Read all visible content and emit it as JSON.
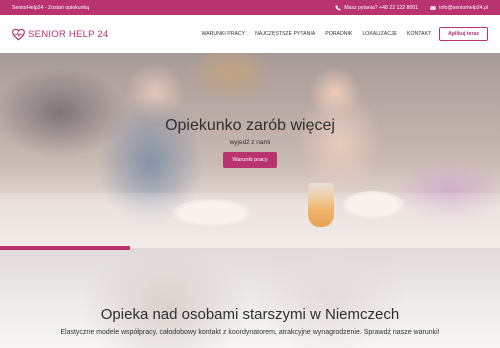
{
  "topbar": {
    "left_text": "SeniorHelp24 - Zostań opiekunką",
    "phone_text": "Masz pytania? +48 22 122 8001",
    "email_text": "info@seniorhelp24.pl"
  },
  "header": {
    "logo_text": "SENIOR HELP 24",
    "nav": [
      "WARUNKI PRACY",
      "NAJCZĘSTSZE PYTANIA",
      "PORADNIK",
      "LOKALIZACJE",
      "KONTAKT"
    ],
    "apply_label": "Aplikuj teraz"
  },
  "hero": {
    "title": "Opiekunko zarób więcej",
    "subtitle": "wyjedź z nami",
    "button_label": "Warunki pracy"
  },
  "section2": {
    "title": "Opieka nad osobami starszymi w Niemczech",
    "text": "Elastyczne modele współpracy, całodobowy kontakt z koordynatorem, atrakcyjne wynagrodzenie. Sprawdź nasze warunki!"
  },
  "colors": {
    "brand": "#b8336f"
  }
}
